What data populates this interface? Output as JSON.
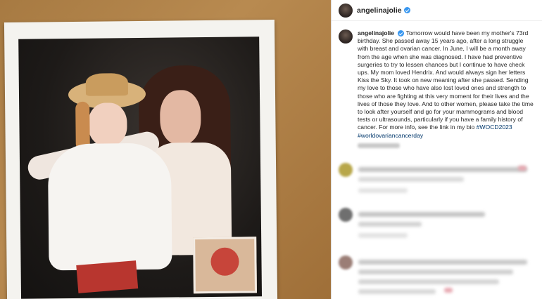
{
  "post": {
    "username": "angelinajolie",
    "caption_author": "angelinajolie",
    "caption_text": "Tomorrow would have been my mother's 73rd birthday. She passed away 15 years ago, after a long struggle with breast and ovarian cancer. In June, I will be a month away from the age when she was diagnosed. I have had preventive surgeries to try to lessen chances but I continue to have check ups. My mom loved Hendrix. And would always sign her letters Kiss the Sky. It took on new meaning after she passed. Sending my love to those who have also lost loved ones and strength to those who are fighting at this very moment for their lives and the lives of those they love. And to other women, please take the time to look after yourself and go for your mammograms and blood tests or ultrasounds, particularly if you have a family history of cancer. For more info, see the link in my bio",
    "hashtags": "#WOCD2023 #worldovariancancerday"
  },
  "colors": {
    "verified": "#3897f0",
    "hashtag": "#00376b",
    "wall": "#a77a42"
  },
  "icons": [
    "verified-badge-icon"
  ]
}
